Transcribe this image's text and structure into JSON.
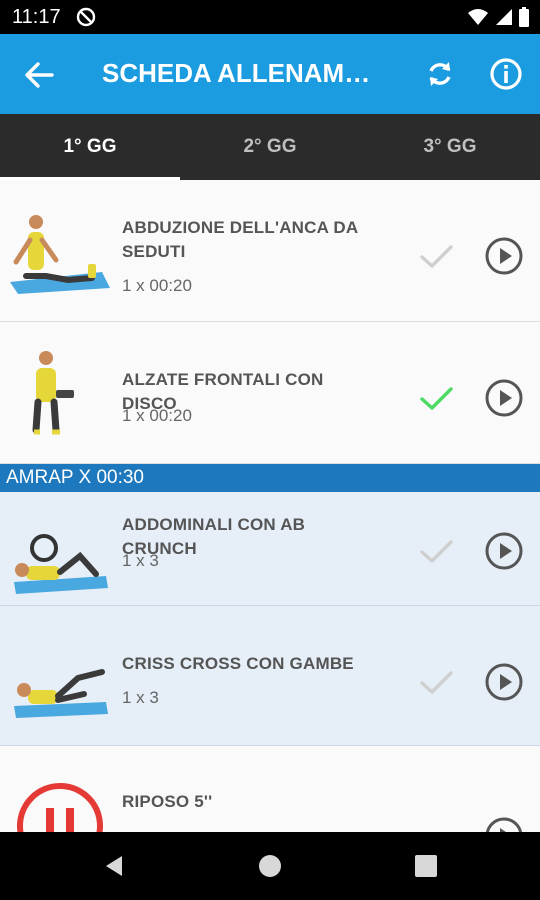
{
  "status_bar": {
    "time": "11:17"
  },
  "app_bar": {
    "title": "SCHEDA ALLENAMENTO"
  },
  "tabs": [
    {
      "label": "1° GG",
      "active": true
    },
    {
      "label": "2° GG",
      "active": false
    },
    {
      "label": "3° GG",
      "active": false
    }
  ],
  "exercises": [
    {
      "title": "ABDUZIONE DELL'ANCA DA SEDUTI",
      "detail": "1 x 00:20",
      "done": false
    },
    {
      "title": "ALZATE FRONTALI CON DISCO",
      "detail": "1 x 00:20",
      "done": true
    }
  ],
  "amrap": {
    "label": "AMRAP X 00:30",
    "exercises": [
      {
        "title": "ADDOMINALI CON AB CRUNCH",
        "detail": "1 x 3",
        "done": false
      },
      {
        "title": "CRISS CROSS CON GAMBE",
        "detail": "1 x 3",
        "done": false
      }
    ]
  },
  "rest": {
    "title": "RIPOSO 5''"
  },
  "colors": {
    "primary": "#1b9be0",
    "section": "#1d78bd",
    "check_done": "#4cd964",
    "check_pending": "#cfcfcf",
    "rest_red": "#e53935"
  },
  "icons": [
    "back-arrow-icon",
    "sync-icon",
    "info-icon",
    "check-icon",
    "play-icon",
    "timer-icon"
  ]
}
